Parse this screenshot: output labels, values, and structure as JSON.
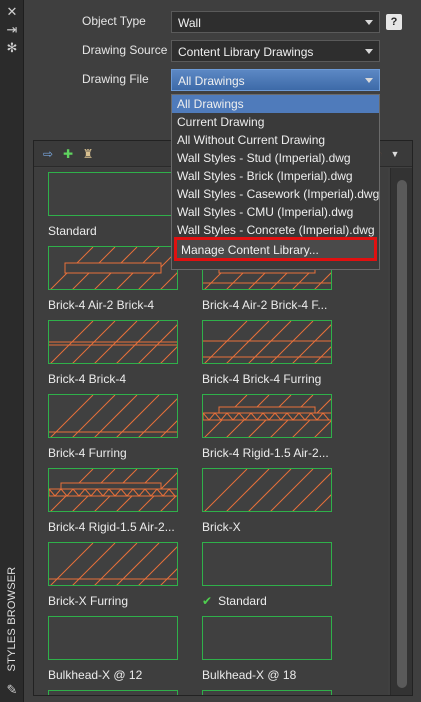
{
  "palette": {
    "title": "STYLES BROWSER",
    "close_icon": "close-icon",
    "pin_icon": "pin-icon",
    "settings_icon": "settings-icon",
    "edit_icon": "edit-icon"
  },
  "fields": {
    "object_type_label": "Object Type",
    "object_type_value": "Wall",
    "drawing_source_label": "Drawing Source",
    "drawing_source_value": "Content Library Drawings",
    "drawing_file_label": "Drawing File",
    "drawing_file_value": "All Drawings"
  },
  "dropdown": {
    "options": [
      "All Drawings",
      "Current Drawing",
      "All Without Current Drawing",
      "Wall Styles - Stud (Imperial).dwg",
      "Wall Styles - Brick (Imperial).dwg",
      "Wall Styles - Casework (Imperial).dwg",
      "Wall Styles - CMU (Imperial).dwg",
      "Wall Styles - Concrete (Imperial).dwg"
    ],
    "selected": "All Drawings",
    "manage_label": "Manage Content Library..."
  },
  "styles": [
    {
      "name": "Standard"
    },
    {
      "name": "Brick-4 Air-2 Brick-4"
    },
    {
      "name": "Brick-4 Air-2 Brick-4 F..."
    },
    {
      "name": "Brick-4 Brick-4"
    },
    {
      "name": "Brick-4 Brick-4 Furring"
    },
    {
      "name": "Brick-4 Furring"
    },
    {
      "name": "Brick-4 Rigid-1.5 Air-2..."
    },
    {
      "name": "Brick-4 Rigid-1.5 Air-2..."
    },
    {
      "name": "Brick-X"
    },
    {
      "name": "Brick-X Furring"
    },
    {
      "name": "Standard"
    },
    {
      "name": "Bulkhead-X @ 12"
    },
    {
      "name": "Bulkhead-X @ 18"
    }
  ],
  "current_style_check": "✔",
  "colors": {
    "accent": "#4f7bbb",
    "hatch": "#e8703a",
    "thumb_border": "#2fb04a",
    "highlight_border": "#e01010"
  }
}
